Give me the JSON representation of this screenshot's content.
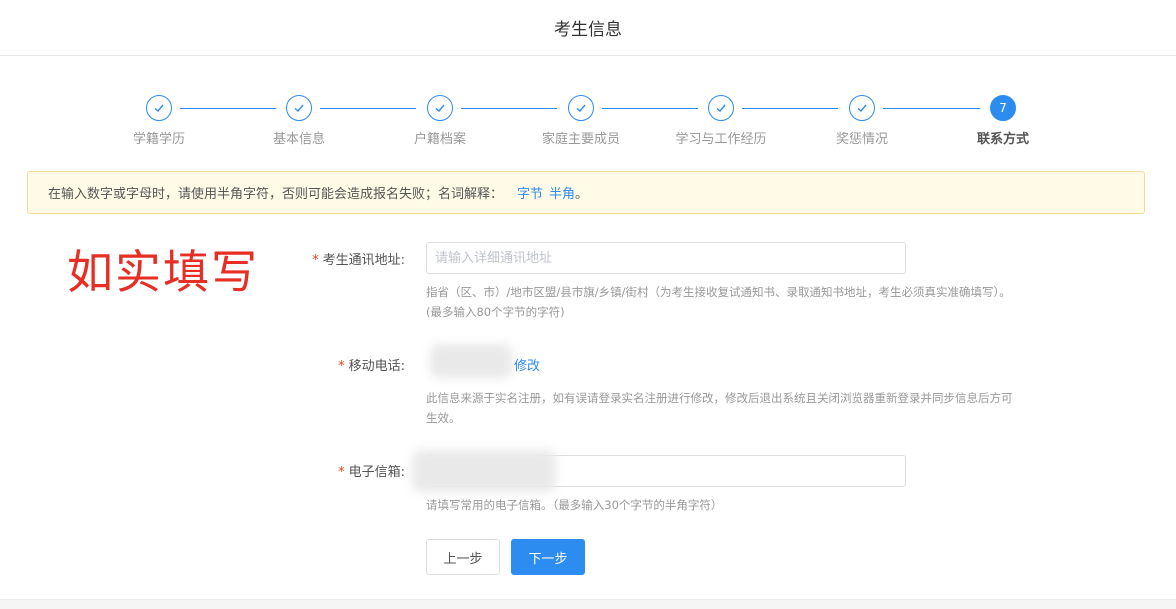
{
  "header": {
    "title": "考生信息"
  },
  "steps": [
    {
      "label": "学籍学历",
      "done": true
    },
    {
      "label": "基本信息",
      "done": true
    },
    {
      "label": "户籍档案",
      "done": true
    },
    {
      "label": "家庭主要成员",
      "done": true
    },
    {
      "label": "学习与工作经历",
      "done": true
    },
    {
      "label": "奖惩情况",
      "done": true
    },
    {
      "label": "联系方式",
      "done": false,
      "number": "7"
    }
  ],
  "notice": {
    "text": "在输入数字或字母时，请使用半角字符，否则可能会造成报名失败；名词解释：",
    "link_byte": "字节",
    "link_halfwidth": "半角",
    "suffix": "。"
  },
  "stamp_text": "如实填写",
  "form": {
    "address": {
      "label": "考生通讯地址:",
      "placeholder": "请输入详细通讯地址",
      "value": "",
      "hint_line1": "指省（区、市）/地市区盟/县市旗/乡镇/街村（为考生接收复试通知书、录取通知书地址，考生必须真实准确填写）。",
      "hint_line2": "(最多输入80个字节的字符)"
    },
    "phone": {
      "label": "移动电话:",
      "modify_label": "修改",
      "hint_line1": "此信息来源于实名注册，如有误请登录实名注册进行修改，修改后退出系统且关闭浏览器重新登录并同步信息后方可",
      "hint_line2": "生效。"
    },
    "email": {
      "label": "电子信箱:",
      "value": "",
      "hint": "请填写常用的电子信箱。（最多输入30个字节的半角字符）"
    },
    "required_mark": "*"
  },
  "buttons": {
    "prev": "上一步",
    "next": "下一步"
  },
  "colors": {
    "primary": "#2d8cf0",
    "required": "#ed4014",
    "stamp": "#e62e24",
    "notice_bg": "#fffbe6"
  }
}
